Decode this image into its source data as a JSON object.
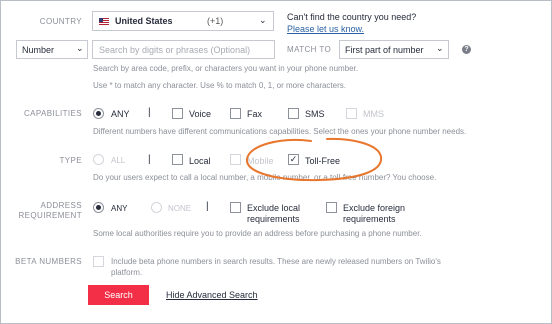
{
  "country": {
    "label": "COUNTRY",
    "selected": "United States",
    "code": "(+1)",
    "help_line1": "Can't find the country you need?",
    "help_link": "Please let us know."
  },
  "search": {
    "type_selected": "Number",
    "placeholder": "Search by digits or phrases (Optional)",
    "match_label": "MATCH TO",
    "match_selected": "First part of number",
    "help_line1": "Search by area code, prefix, or characters you want in your phone number.",
    "help_line2": "Use * to match any character. Use % to match 0, 1, or more characters."
  },
  "capabilities": {
    "label": "CAPABILITIES",
    "options": [
      "ANY",
      "Voice",
      "Fax",
      "SMS",
      "MMS"
    ],
    "help": "Different numbers have different communications capabilities. Select the ones your phone number needs."
  },
  "type": {
    "label": "TYPE",
    "options": [
      "ALL",
      "Local",
      "Mobile",
      "Toll-Free"
    ],
    "help": "Do your users expect to call a local number, a mobile number, or a toll-free number? You choose."
  },
  "address": {
    "label_line1": "ADDRESS",
    "label_line2": "REQUIREMENT",
    "options": [
      "ANY",
      "NONE"
    ],
    "exclude_local_1": "Exclude local",
    "exclude_local_2": "requirements",
    "exclude_foreign_1": "Exclude foreign",
    "exclude_foreign_2": "requirements",
    "help": "Some local authorities require you to provide an address before purchasing a phone number."
  },
  "beta": {
    "label": "BETA NUMBERS",
    "text_line1": "Include beta phone numbers in search results. These are newly released numbers on Twilio's",
    "text_line2": "platform."
  },
  "actions": {
    "search_label": "Search",
    "hide_label": "Hide Advanced Search"
  },
  "colors": {
    "primary_red": "#f22f46",
    "annotation_orange": "#e8762d",
    "link_blue": "#2a62a3"
  },
  "icons": {
    "flag": "us-flag-icon",
    "chevron": "chevron-down-icon",
    "help": "help-circle-icon"
  }
}
